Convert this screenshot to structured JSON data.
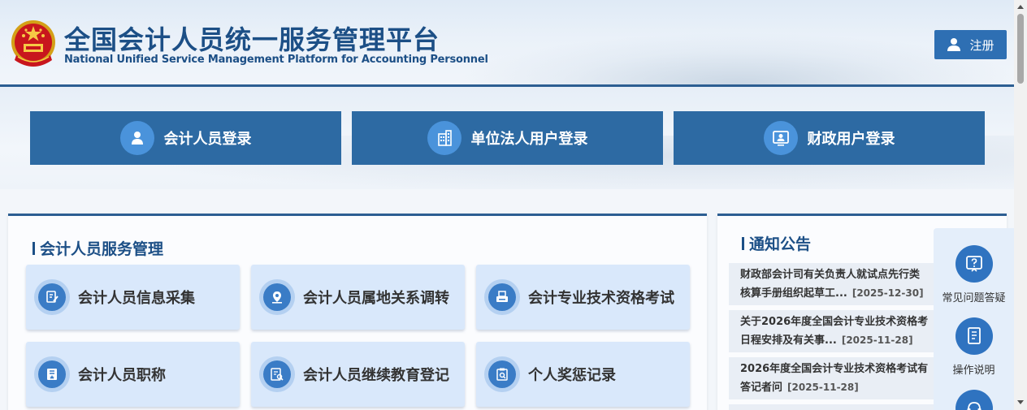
{
  "header": {
    "title_cn": "全国会计人员统一服务管理平台",
    "title_en": "National Unified Service Management Platform for Accounting Personnel",
    "register_label": "注册",
    "register_icon": "user-icon"
  },
  "login": {
    "items": [
      {
        "label": "会计人员登录",
        "icon": "user-icon"
      },
      {
        "label": "单位法人用户登录",
        "icon": "building-icon"
      },
      {
        "label": "财政用户登录",
        "icon": "monitor-user-icon"
      }
    ]
  },
  "services": {
    "title": "会计人员服务管理",
    "items": [
      {
        "label": "会计人员信息采集",
        "icon": "edit-doc-icon"
      },
      {
        "label": "会计人员属地关系调转",
        "icon": "location-icon"
      },
      {
        "label": "会计专业技术资格考试",
        "icon": "printer-doc-icon"
      },
      {
        "label": "会计人员职称",
        "icon": "certificate-icon"
      },
      {
        "label": "会计人员继续教育登记",
        "icon": "search-doc-icon"
      },
      {
        "label": "个人奖惩记录",
        "icon": "clipboard-search-icon"
      }
    ]
  },
  "notices": {
    "title": "通知公告",
    "items": [
      {
        "line1": "财政部会计司有关负责人就试点先行类",
        "line2": "核算手册组织起草工...",
        "date": "[2025-12-30]"
      },
      {
        "line1": "关于2026年度全国会计专业技术资格考",
        "line2": "日程安排及有关事...",
        "date": "[2025-11-28]"
      },
      {
        "line1": "2026年度全国会计专业技术资格考试有",
        "line2": "答记者问",
        "date": "[2025-11-28]"
      }
    ]
  },
  "float_menu": {
    "items": [
      {
        "label": "常见问题答疑",
        "icon": "question-icon"
      },
      {
        "label": "操作说明",
        "icon": "book-icon"
      },
      {
        "label": "",
        "icon": "headset-icon"
      }
    ]
  },
  "colors": {
    "primary": "#2d6aa3",
    "title": "#1c4f86",
    "card": "#d9e8fb"
  }
}
